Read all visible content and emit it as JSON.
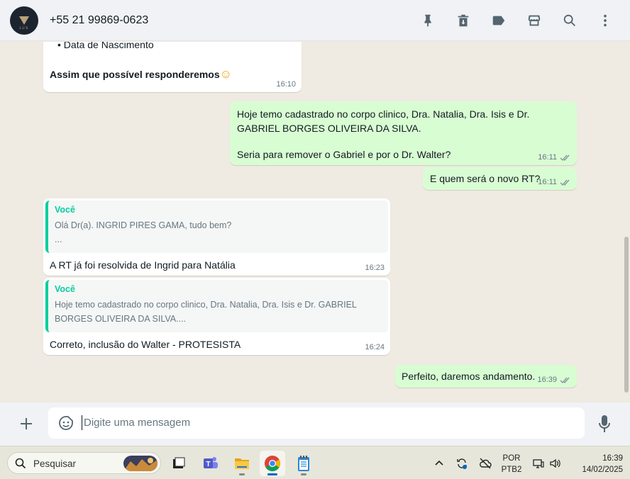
{
  "header": {
    "contact": "+55 21 99869-0623",
    "avatar_text": "LUX",
    "icons": [
      "pin-icon",
      "archive-icon",
      "label-icon",
      "store-icon",
      "search-icon",
      "menu-icon"
    ]
  },
  "messages": [
    {
      "dir": "in",
      "bullet": "Data de Nascimento",
      "bold": "Assim que possível responderemos",
      "emoji": "☺",
      "time": "16:10"
    },
    {
      "dir": "out",
      "text1": "Hoje temo cadastrado no corpo clinico, Dra. Natalia, Dra. Isis e Dr. GABRIEL BORGES OLIVEIRA DA SILVA.",
      "text2": "Seria para remover o Gabriel e por o Dr. Walter?",
      "time": "16:11"
    },
    {
      "dir": "out",
      "text": "E quem será o novo RT?",
      "time": "16:11"
    },
    {
      "dir": "in",
      "quote_name": "Você",
      "quote_line1": "Olá Dr(a). INGRID PIRES GAMA, tudo bem?",
      "quote_line2": "...",
      "text": "A RT já foi resolvida de Ingrid para Natália",
      "time": "16:23"
    },
    {
      "dir": "in",
      "quote_name": "Você",
      "quote_text": "Hoje temo cadastrado no corpo clinico, Dra. Natalia, Dra. Isis e Dr. GABRIEL BORGES OLIVEIRA DA SILVA....",
      "text": "Correto, inclusão do Walter - PROTESISTA",
      "time": "16:24"
    },
    {
      "dir": "out",
      "text": "Perfeito, daremos andamento.",
      "time": "16:39"
    }
  ],
  "composer": {
    "placeholder": "Digite uma mensagem"
  },
  "taskbar": {
    "search_placeholder": "Pesquisar",
    "lang_line1": "POR",
    "lang_line2": "PTB2",
    "time": "16:39",
    "date": "14/02/2025",
    "colors": {
      "accent": "#0067c0",
      "green_quote": "#06cf9c",
      "bubble_out": "#d9fdd3"
    }
  }
}
